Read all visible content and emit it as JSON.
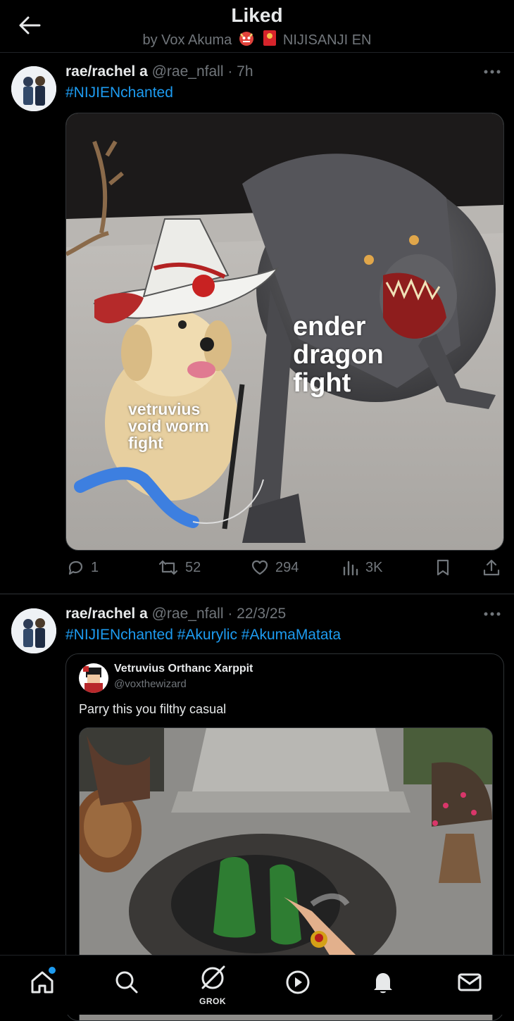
{
  "header": {
    "title": "Liked",
    "subtitle_prefix": "by Vox Akuma",
    "subtitle_suffix": "NIJISANJI EN"
  },
  "tweets": [
    {
      "name": "rae/rachel a",
      "handle": "@rae_nfall",
      "time": "· 7h",
      "hashtags": "#NIJIENchanted",
      "meme": {
        "text_right": [
          "ender",
          "dragon",
          "fight"
        ],
        "text_left": [
          "vetruvius",
          "void worm",
          "fight"
        ]
      },
      "stats": {
        "replies": "1",
        "reposts": "52",
        "likes": "294",
        "views": "3K"
      }
    },
    {
      "name": "rae/rachel a",
      "handle": "@rae_nfall",
      "time": "· 22/3/25",
      "hashtags": "#NIJIENchanted #Akurylic #AkumaMatata",
      "quote": {
        "name": "Vetruvius Orthanc Xarppit",
        "handle": "@voxthewizard",
        "text": "Parry this you filthy casual"
      }
    }
  ],
  "tabbar": {
    "items": [
      "home-icon",
      "search-icon",
      "grok-icon",
      "video-icon",
      "notifications-icon",
      "messages-icon"
    ],
    "grok_label": "GROK"
  },
  "colors": {
    "accent": "#1d9bf0",
    "muted": "#71767b",
    "text": "#e7e9ea",
    "background": "#000000"
  }
}
